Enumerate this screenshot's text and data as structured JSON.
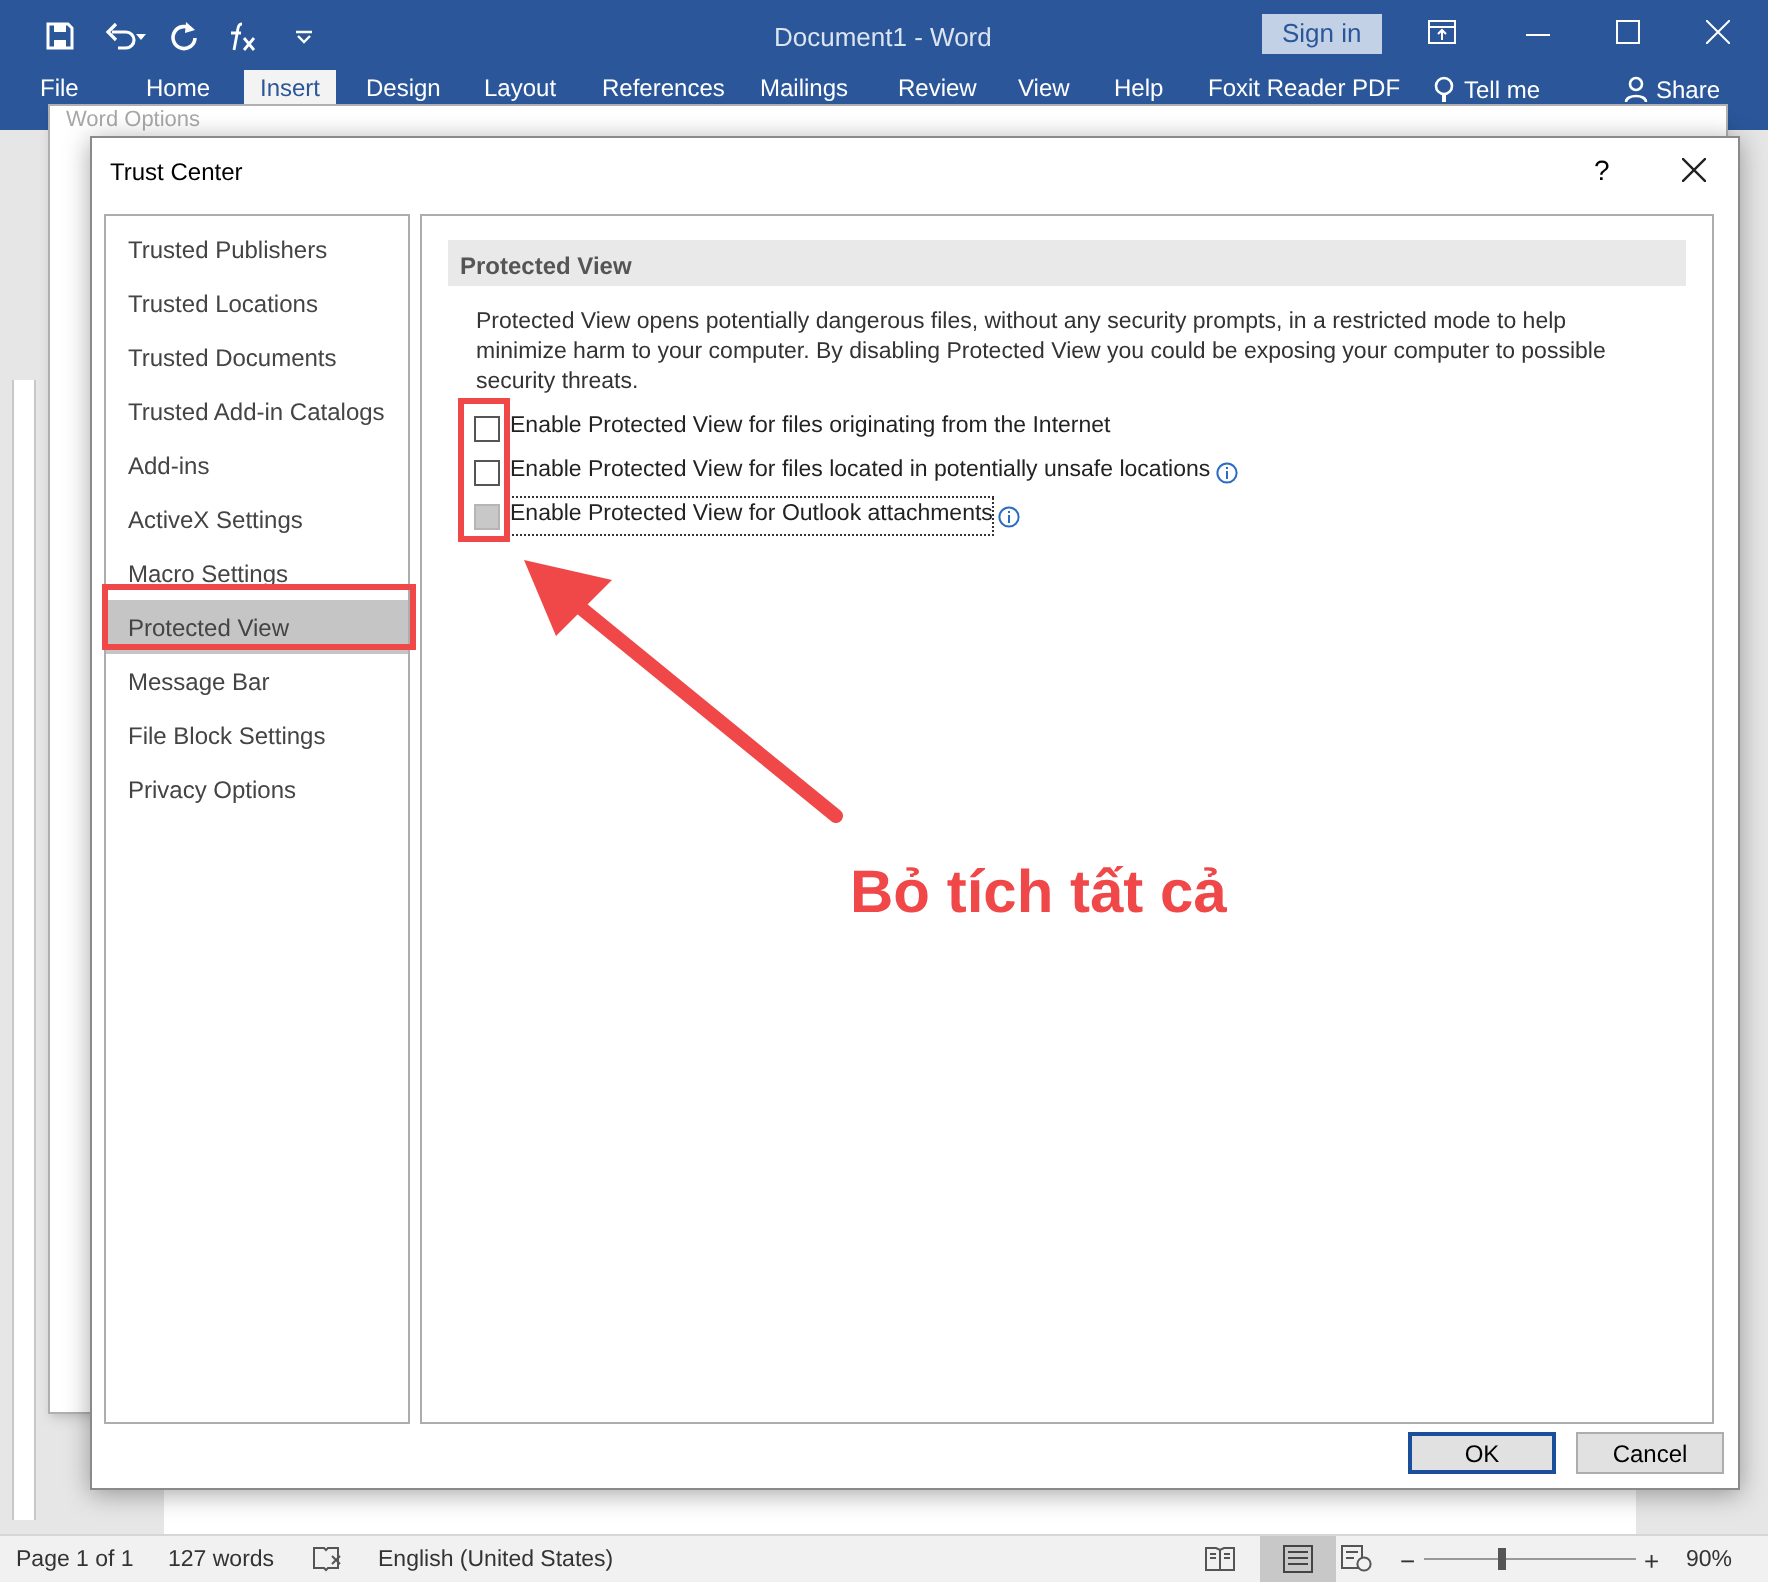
{
  "window": {
    "title": "Document1  -  Word",
    "sign_in": "Sign in"
  },
  "ribbon_tabs": [
    {
      "label": "File",
      "selected": false
    },
    {
      "label": "Home",
      "selected": false
    },
    {
      "label": "Insert",
      "selected": true
    },
    {
      "label": "Design",
      "selected": false
    },
    {
      "label": "Layout",
      "selected": false
    },
    {
      "label": "References",
      "selected": false
    },
    {
      "label": "Mailings",
      "selected": false
    },
    {
      "label": "Review",
      "selected": false
    },
    {
      "label": "View",
      "selected": false
    },
    {
      "label": "Help",
      "selected": false
    },
    {
      "label": "Foxit Reader PDF",
      "selected": false
    }
  ],
  "tell_me": "Tell me",
  "share": "Share",
  "options_dialog": {
    "title": "Word Options"
  },
  "dialog": {
    "title": "Trust Center",
    "help": "?",
    "nav": [
      {
        "label": "Trusted Publishers",
        "selected": false
      },
      {
        "label": "Trusted Locations",
        "selected": false
      },
      {
        "label": "Trusted Documents",
        "selected": false
      },
      {
        "label": "Trusted Add-in Catalogs",
        "selected": false
      },
      {
        "label": "Add-ins",
        "selected": false
      },
      {
        "label": "ActiveX Settings",
        "selected": false
      },
      {
        "label": "Macro Settings",
        "selected": false
      },
      {
        "label": "Protected View",
        "selected": true
      },
      {
        "label": "Message Bar",
        "selected": false
      },
      {
        "label": "File Block Settings",
        "selected": false
      },
      {
        "label": "Privacy Options",
        "selected": false
      }
    ],
    "section_title": "Protected View",
    "description": "Protected View opens potentially dangerous files, without any security prompts, in a restricted mode to help minimize harm to your computer. By disabling Protected View you could be exposing your computer to possible security threats.",
    "options": [
      {
        "label": "Enable Protected View for files originating from the Internet",
        "checked": false,
        "disabled": false,
        "info": false,
        "focused": false
      },
      {
        "label": "Enable Protected View for files located in potentially unsafe locations",
        "checked": false,
        "disabled": false,
        "info": true,
        "focused": false
      },
      {
        "label": "Enable Protected View for Outlook attachments",
        "checked": false,
        "disabled": true,
        "info": true,
        "focused": true
      }
    ],
    "buttons": [
      {
        "label": "OK",
        "default": true
      },
      {
        "label": "Cancel",
        "default": false
      }
    ]
  },
  "annotation": {
    "text": "Bỏ tích tất cả"
  },
  "status_bar": {
    "page": "Page 1 of 1",
    "words": "127 words",
    "language": "English (United States)",
    "zoom_out": "−",
    "zoom_in": "+",
    "zoom": "90%",
    "zoom_level": {
      "level": 0.37
    }
  }
}
